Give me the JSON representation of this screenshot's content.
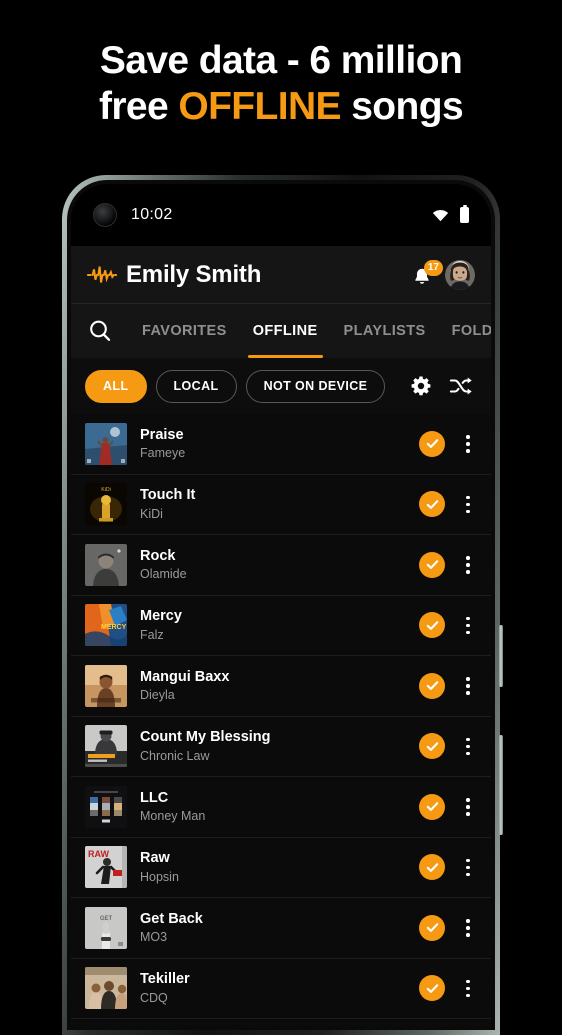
{
  "headline": {
    "line1": "Save data - 6 million",
    "line2_pre": "free ",
    "line2_accent": "OFFLINE",
    "line2_post": " songs"
  },
  "colors": {
    "accent": "#F59A12",
    "background": "#000000",
    "screen_bg": "#0b0b0b",
    "header_bg": "#151515",
    "text_primary": "#ffffff",
    "text_secondary": "#9a9a9a"
  },
  "status_bar": {
    "time": "10:02",
    "wifi_icon": "wifi-icon",
    "battery_icon": "battery-icon",
    "camera_icon": "front-camera-punch-hole"
  },
  "app_header": {
    "logo_icon": "waveform-logo-icon",
    "title": "Emily Smith",
    "bell_icon": "notification-bell-icon",
    "notification_count": "17",
    "avatar_icon": "user-avatar"
  },
  "tabs": {
    "search_icon": "search-icon",
    "items": [
      {
        "label": "FAVORITES",
        "active": false
      },
      {
        "label": "OFFLINE",
        "active": true
      },
      {
        "label": "PLAYLISTS",
        "active": false
      },
      {
        "label": "FOLDERS",
        "active": false
      }
    ]
  },
  "filters": {
    "chips": [
      {
        "label": "ALL",
        "active": true
      },
      {
        "label": "LOCAL",
        "active": false
      },
      {
        "label": "NOT ON DEVICE",
        "active": false
      }
    ],
    "settings_icon": "gear-icon",
    "shuffle_icon": "shuffle-icon"
  },
  "songs": [
    {
      "title": "Praise",
      "artist": "Fameye",
      "downloaded": true,
      "art": "praise"
    },
    {
      "title": "Touch It",
      "artist": "KiDi",
      "downloaded": true,
      "art": "touchit"
    },
    {
      "title": "Rock",
      "artist": "Olamide",
      "downloaded": true,
      "art": "rock"
    },
    {
      "title": "Mercy",
      "artist": "Falz",
      "downloaded": true,
      "art": "mercy"
    },
    {
      "title": "Mangui Baxx",
      "artist": "Dieyla",
      "downloaded": true,
      "art": "mangui"
    },
    {
      "title": "Count My Blessing",
      "artist": "Chronic Law",
      "downloaded": true,
      "art": "count"
    },
    {
      "title": "LLC",
      "artist": "Money Man",
      "downloaded": true,
      "art": "llc"
    },
    {
      "title": "Raw",
      "artist": "Hopsin",
      "downloaded": true,
      "art": "raw"
    },
    {
      "title": "Get Back",
      "artist": "MO3",
      "downloaded": true,
      "art": "getback"
    },
    {
      "title": "Tekiller",
      "artist": "CDQ",
      "downloaded": true,
      "art": "tekiller"
    }
  ],
  "row_icons": {
    "check_icon": "download-complete-check-icon",
    "menu_icon": "overflow-menu-icon"
  }
}
